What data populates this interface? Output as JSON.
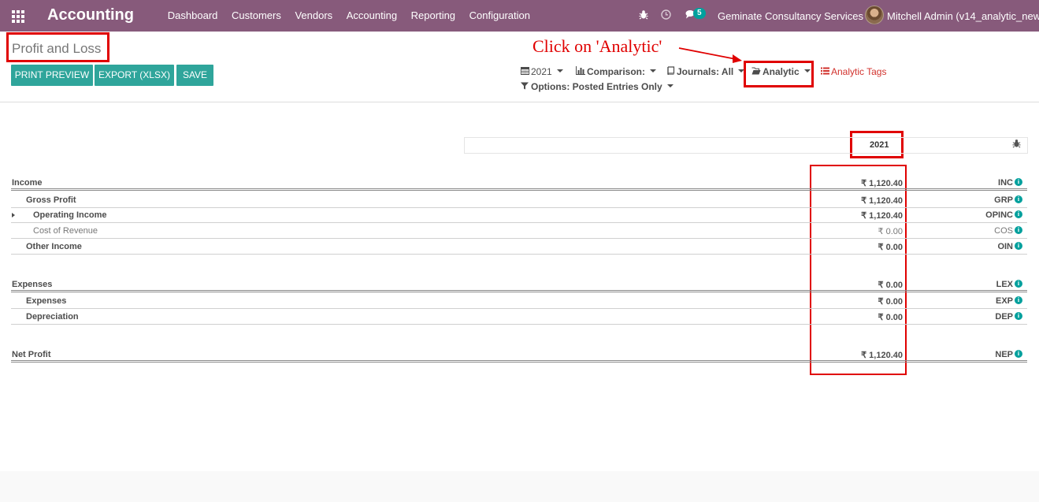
{
  "navbar": {
    "brand": "Accounting",
    "menu": [
      "Dashboard",
      "Customers",
      "Vendors",
      "Accounting",
      "Reporting",
      "Configuration"
    ],
    "messages_count": "5",
    "company": "Geminate Consultancy Services",
    "user": "Mitchell Admin (v14_analytic_new)",
    "color": "#875a7b"
  },
  "page": {
    "title": "Profit and Loss"
  },
  "buttons": {
    "print": "PRINT PREVIEW",
    "export": "EXPORT (XLSX)",
    "save": "SAVE",
    "color": "#2fa59b"
  },
  "filters": {
    "year": "2021",
    "comparison": "Comparison:",
    "journals": "Journals: All",
    "analytic": "Analytic",
    "analytic_tags": "Analytic Tags",
    "options": "Options: Posted Entries Only"
  },
  "annotation": {
    "text": "Click on 'Analytic'",
    "color": "#e00000"
  },
  "report": {
    "column_header": "2021",
    "rows": [
      {
        "label": "Income",
        "amount": "₹ 1,120.40",
        "code": "INC"
      },
      {
        "label": "Gross Profit",
        "amount": "₹ 1,120.40",
        "code": "GRP"
      },
      {
        "label": "Operating Income",
        "amount": "₹ 1,120.40",
        "code": "OPINC"
      },
      {
        "label": "Cost of Revenue",
        "amount": "₹ 0.00",
        "code": "COS"
      },
      {
        "label": "Other Income",
        "amount": "₹ 0.00",
        "code": "OIN"
      },
      {
        "label": "Expenses",
        "amount": "₹ 0.00",
        "code": "LEX"
      },
      {
        "label": "Expenses",
        "amount": "₹ 0.00",
        "code": "EXP"
      },
      {
        "label": "Depreciation",
        "amount": "₹ 0.00",
        "code": "DEP"
      },
      {
        "label": "Net Profit",
        "amount": "₹ 1,120.40",
        "code": "NEP"
      }
    ]
  }
}
